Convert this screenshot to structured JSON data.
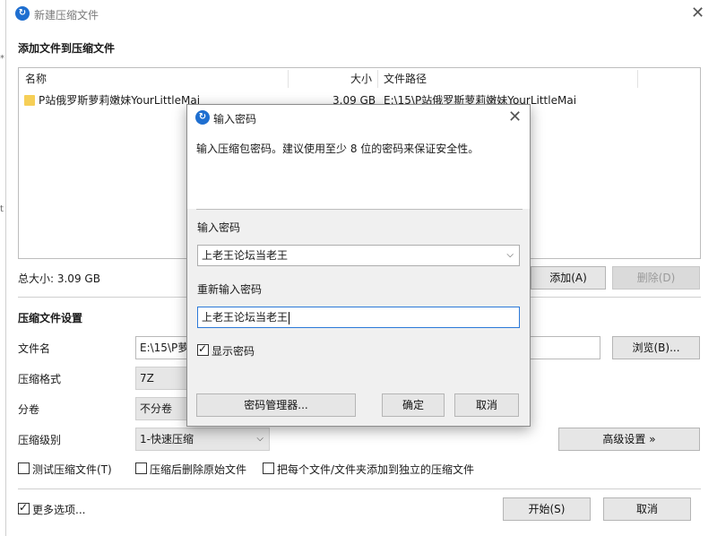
{
  "main_window": {
    "title": "新建压缩文件",
    "add_files_title": "添加文件到压缩文件",
    "columns": {
      "name": "名称",
      "size": "大小",
      "path": "文件路径"
    },
    "files": [
      {
        "name": "P站俄罗斯萝莉嫩妹YourLittleMai",
        "size": "3.09 GB",
        "path": "E:\\15\\P站俄罗斯萝莉嫩妹YourLittleMai"
      }
    ],
    "total_size": "总大小: 3.09 GB",
    "add_button": "添加(A)",
    "delete_button": "删除(D)",
    "settings_title": "压缩文件设置",
    "filename_label": "文件名",
    "filename_value": "E:\\15\\P萝",
    "browse_button": "浏览(B)...",
    "format_label": "压缩格式",
    "format_value": "7Z",
    "split_label": "分卷",
    "split_value": "不分卷",
    "level_label": "压缩级别",
    "level_value": "1-快速压缩",
    "advanced_button": "高级设置 »",
    "test_checkbox": "测试压缩文件(T)",
    "delete_after_checkbox": "压缩后删除原始文件",
    "separate_checkbox": "把每个文件/文件夹添加到独立的压缩文件",
    "more_options_checkbox": "更多选项...",
    "start_button": "开始(S)",
    "cancel_button": "取消"
  },
  "dialog": {
    "title": "输入密码",
    "description": "输入压缩包密码。建议使用至少 8 位的密码来保证安全性。",
    "password_label": "输入密码",
    "password_value": "上老王论坛当老王",
    "reenter_label": "重新输入密码",
    "reenter_value": "上老王论坛当老王",
    "show_password_label": "显示密码",
    "manager_button": "密码管理器...",
    "ok_button": "确定",
    "cancel_button": "取消"
  },
  "icons": {
    "app": "app-logo-icon",
    "folder": "folder-icon",
    "close": "close-icon",
    "dropdown": "chevron-down-icon"
  },
  "colors": {
    "accent": "#2b79d8",
    "app_icon": "#1f6fd0",
    "folder": "#f6cf57"
  }
}
